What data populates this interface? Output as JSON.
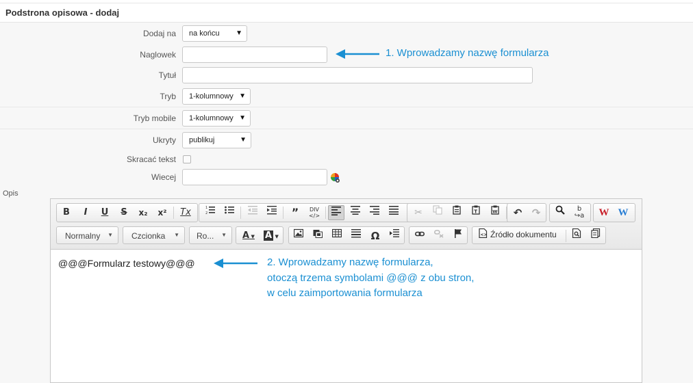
{
  "page": {
    "title": "Podstrona opisowa - dodaj"
  },
  "form": {
    "dodaj_na": {
      "label": "Dodaj na",
      "value": "na końcu"
    },
    "naglowek": {
      "label": "Naglowek",
      "value": ""
    },
    "tytul": {
      "label": "Tytuł",
      "value": ""
    },
    "tryb": {
      "label": "Tryb",
      "value": "1-kolumnowy"
    },
    "tryb_mobile": {
      "label": "Tryb mobile",
      "value": "1-kolumnowy"
    },
    "ukryty": {
      "label": "Ukryty",
      "value": "publikuj"
    },
    "skracac": {
      "label": "Skracać tekst",
      "checked": false
    },
    "wiecej": {
      "label": "Wiecej",
      "value": ""
    },
    "opis": {
      "label": "Opis"
    }
  },
  "annotations": {
    "a1": "1. Wprowadzamy nazwę formularza",
    "a2_line1": "2. Wprowadzamy nazwę formularza,",
    "a2_line2": "otoczą trzema symbolami @@@ z obu stron,",
    "a2_line3": "w celu zaimportowania formularza"
  },
  "editor": {
    "format_combo": "Normalny",
    "font_combo": "Czcionka",
    "size_combo": "Ro...",
    "source_label": "Źródło dokumentu",
    "content": "@@@Formularz testowy@@@",
    "buttons": {
      "bold": "B",
      "italic": "I",
      "underline": "U",
      "strike": "S",
      "subscript": "x₂",
      "superscript": "x²",
      "remove_format": "Tx",
      "special_char": "Ω",
      "font_color": "A",
      "bg_color": "A",
      "w_red": "W",
      "w_blue": "W"
    }
  },
  "colors": {
    "annotation": "#1a8fd2",
    "w_red": "#c8202a",
    "w_blue": "#2a7fd4"
  }
}
